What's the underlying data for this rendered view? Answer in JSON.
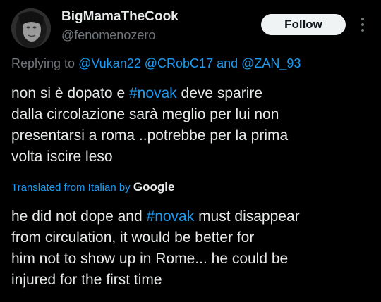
{
  "author": {
    "display_name": "BigMamaTheCook",
    "handle": "@fenomenozero"
  },
  "follow_label": "Follow",
  "reply": {
    "prefix": "Replying to ",
    "mention_1": "@Vukan22",
    "mention_2": "@CRobC17",
    "conjunction": "and",
    "mention_3": "@ZAN_93"
  },
  "original": {
    "line1_a": "non si è dopato e ",
    "line1_hashtag": "#novak",
    "line1_b": " deve sparire",
    "line2": "dalla circolazione sarà meglio per lui non",
    "line3": "presentarsi a roma ..potrebbe per la prima",
    "line4": "volta iscire leso"
  },
  "translation_note": {
    "label": "Translated from Italian by ",
    "provider": "Google"
  },
  "translation": {
    "line1_a": "he did not dope and ",
    "line1_hashtag": "#novak",
    "line1_b": " must disappear",
    "line2": "from circulation, it would be better for",
    "line3": "him not to show up in Rome... he could be",
    "line4": "injured for the first time"
  },
  "colors": {
    "background": "#000000",
    "text": "#e7e9ea",
    "secondary": "#71767b",
    "accent": "#1d9bf0",
    "button_bg": "#eff3f4"
  },
  "icons": {
    "more": "more-vertical-icon"
  }
}
